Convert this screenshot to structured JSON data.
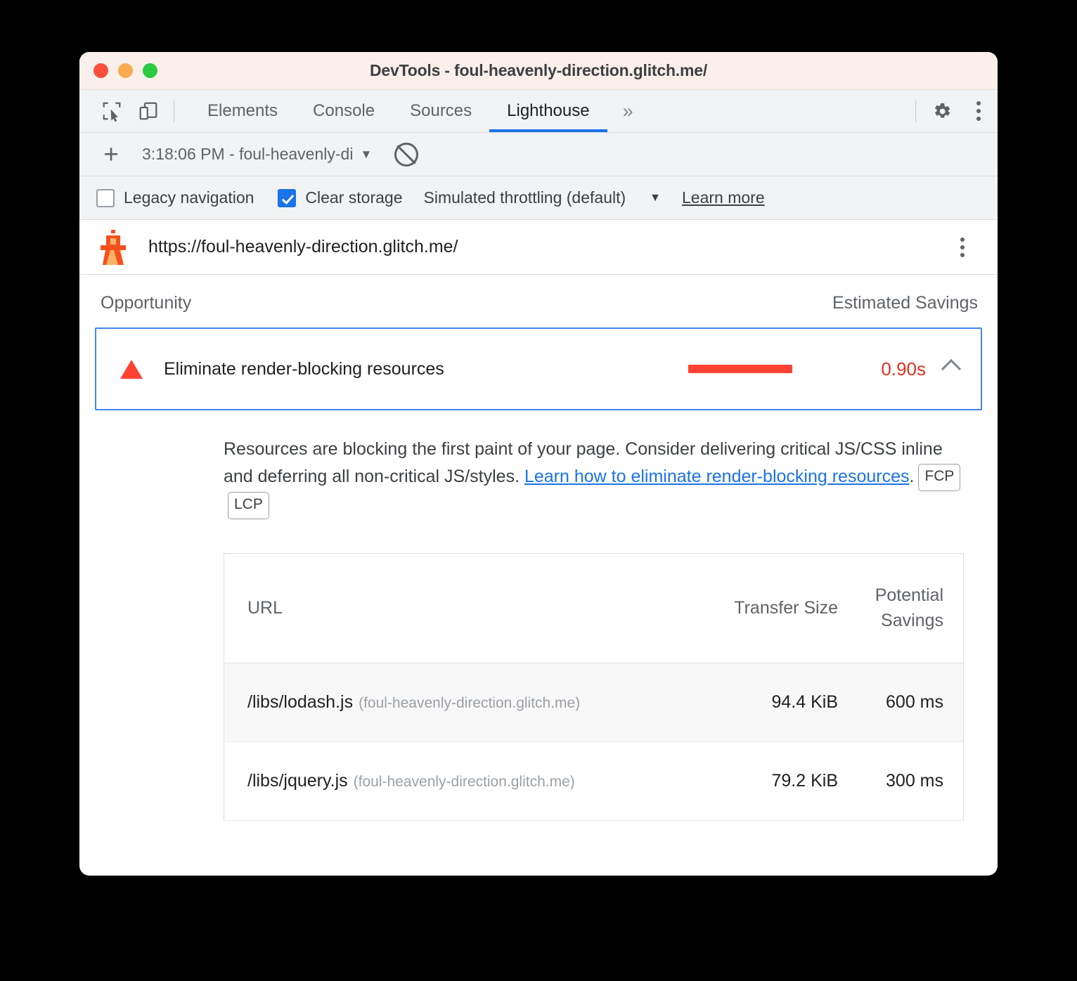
{
  "window": {
    "title": "DevTools - foul-heavenly-direction.glitch.me/"
  },
  "tabbar": {
    "tabs": [
      {
        "label": "Elements"
      },
      {
        "label": "Console"
      },
      {
        "label": "Sources"
      },
      {
        "label": "Lighthouse"
      }
    ],
    "overflow_label": "»",
    "icons": {
      "inspect": "inspect-element-icon",
      "device": "device-toolbar-icon",
      "settings": "gear-icon",
      "more": "more-vertical-icon"
    }
  },
  "runbar": {
    "add_label": "+",
    "run_selector": "3:18:06 PM - foul-heavenly-di",
    "caret": "▼",
    "clear_icon": "no-entry-icon"
  },
  "options": {
    "legacy_navigation": {
      "label": "Legacy navigation",
      "checked": false
    },
    "clear_storage": {
      "label": "Clear storage",
      "checked": true
    },
    "throttling": {
      "label": "Simulated throttling (default)",
      "caret": "▼"
    },
    "learn_more": "Learn more"
  },
  "urlbar": {
    "icon": "lighthouse-icon",
    "url": "https://foul-heavenly-direction.glitch.me/",
    "more_icon": "more-vertical-icon"
  },
  "report": {
    "columns": {
      "opportunity": "Opportunity",
      "estimated_savings": "Estimated Savings"
    },
    "opportunity": {
      "status_icon": "warning-triangle-icon",
      "title": "Eliminate render-blocking resources",
      "savings": "0.90s",
      "expanded": true,
      "collapse_icon": "chevron-up-icon",
      "bar_color": "#ff4234",
      "savings_color": "#e02f20"
    },
    "description": {
      "text_before": "Resources are blocking the first paint of your page. Consider delivering critical JS/CSS inline and deferring all non-critical JS/styles. ",
      "link_text": "Learn how to eliminate render-blocking resources",
      "text_after": ".",
      "badges": [
        "FCP",
        "LCP"
      ]
    },
    "table": {
      "headers": {
        "url": "URL",
        "transfer_size": "Transfer Size",
        "potential_savings": "Potential Savings"
      },
      "rows": [
        {
          "path": "/libs/lodash.js",
          "origin": "(foul-heavenly-direction.glitch.me)",
          "transfer_size": "94.4 KiB",
          "potential_savings": "600 ms"
        },
        {
          "path": "/libs/jquery.js",
          "origin": "(foul-heavenly-direction.glitch.me)",
          "transfer_size": "79.2 KiB",
          "potential_savings": "300 ms"
        }
      ]
    }
  }
}
